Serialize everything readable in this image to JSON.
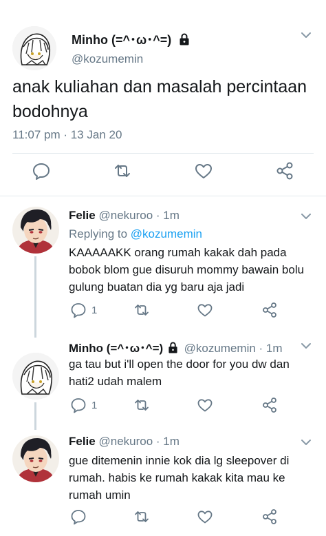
{
  "main_tweet": {
    "display_name": "Minho (=^･ω･^=)",
    "handle": "@kozumemin",
    "text": "anak kuliahan dan masalah percintaan bodohnya",
    "timestamp": "11:07 pm · 13 Jan 20"
  },
  "replies": [
    {
      "display_name": "Felie",
      "handle": "@nekuroo",
      "age": "· 1m",
      "replying_prefix": "Replying to ",
      "replying_to": "@kozumemin",
      "text": "KAAAAAKK orang rumah kakak dah pada bobok blom gue disuruh mommy bawain bolu gulung buatan dia yg baru aja jadi",
      "reply_count": "1"
    },
    {
      "display_name": "Minho (=^･ω･^=)",
      "handle": "@kozumemin",
      "age": "· 1m",
      "text": "ga tau but i'll open the door for you dw dan hati2 udah malem",
      "reply_count": "1"
    },
    {
      "display_name": "Felie",
      "handle": "@nekuroo",
      "age": "· 1m",
      "text": "gue ditemenin innie kok dia lg sleepover di rumah. habis ke rumah kakak kita mau ke rumah umin"
    }
  ],
  "colors": {
    "text": "#14171a",
    "secondary": "#657786",
    "link": "#1da1f2",
    "divider": "#e1e8ed"
  },
  "icons": [
    "chevron-down-icon",
    "lock-icon",
    "reply-icon",
    "retweet-icon",
    "like-icon",
    "share-icon"
  ]
}
